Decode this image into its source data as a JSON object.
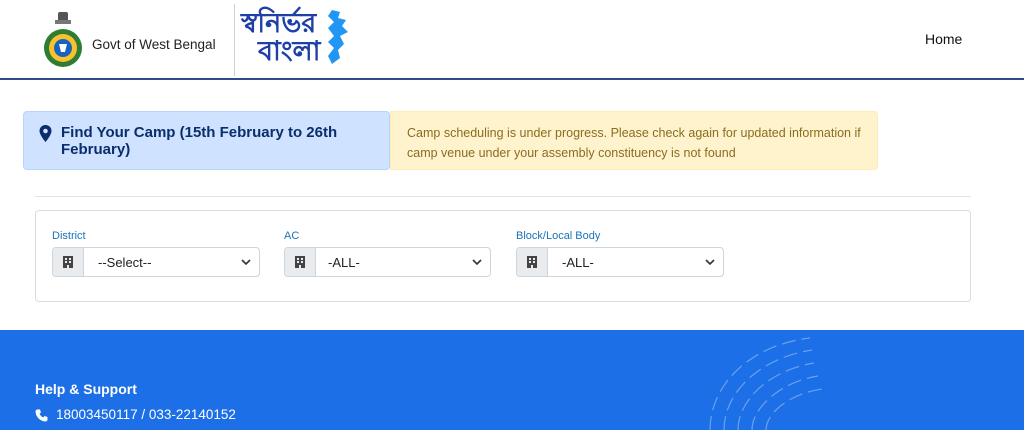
{
  "header": {
    "gov_name": "Govt of West Bengal",
    "brand_line1": "স্বনির্ভর",
    "brand_line2": "বাংলা",
    "nav_home": "Home",
    "brand_color": "#1f3fa8"
  },
  "camp": {
    "title": "Find Your Camp (15th February to 26th February)",
    "notice": "Camp scheduling is under progress. Please check again for updated information if camp venue under your assembly constituency is not found"
  },
  "filters": {
    "district": {
      "label": "District",
      "value": "--Select--",
      "icon": "building-icon"
    },
    "ac": {
      "label": "AC",
      "value": "-ALL-",
      "icon": "building-icon"
    },
    "block": {
      "label": "Block/Local Body",
      "value": "-ALL-",
      "icon": "building-icon"
    }
  },
  "footer": {
    "help_title": "Help & Support",
    "phone": "18003450117 / 033-22140152",
    "background": "#1c6fe6"
  }
}
